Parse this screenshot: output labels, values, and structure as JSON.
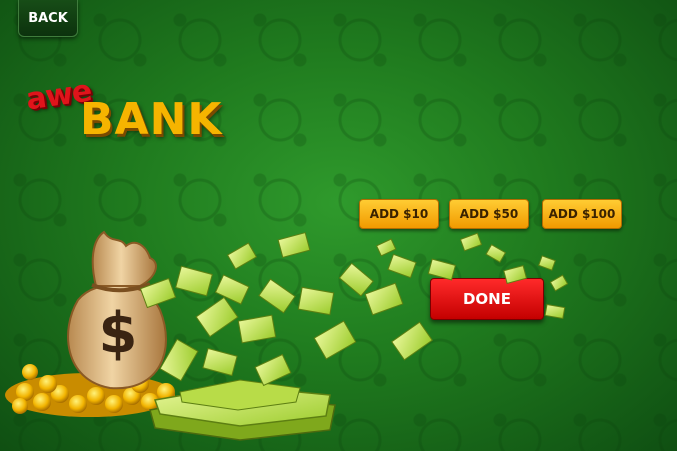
{
  "header": {
    "back_label": "BACK"
  },
  "logo": {
    "brand": "awe",
    "title": "BANK"
  },
  "add_buttons": [
    {
      "label": "ADD $10"
    },
    {
      "label": "ADD $50"
    },
    {
      "label": "ADD $100"
    }
  ],
  "done_label": "DONE",
  "money_bag": {
    "symbol": "$"
  },
  "colors": {
    "background": "#1f7a1e",
    "add_button": "#f6a800",
    "done_button": "#e00000",
    "logo_red": "#e0141b",
    "logo_gold": "#f6b400"
  }
}
